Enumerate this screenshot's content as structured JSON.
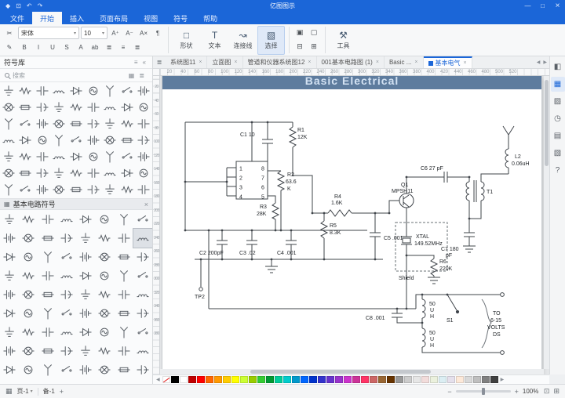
{
  "window": {
    "title": "亿图图示",
    "menu": [
      "文件",
      "开始",
      "插入",
      "页面布局",
      "视图",
      "符号",
      "帮助"
    ],
    "active_menu": "开始",
    "titlebar_icons": [
      {
        "name": "app-logo",
        "glyph": "◆"
      },
      {
        "name": "save",
        "glyph": "⊡"
      },
      {
        "name": "undo",
        "glyph": "↶"
      },
      {
        "name": "redo",
        "glyph": "↷"
      }
    ],
    "window_controls": [
      {
        "name": "minimize",
        "glyph": "—"
      },
      {
        "name": "maximize",
        "glyph": "□"
      },
      {
        "name": "close",
        "glyph": "×"
      }
    ]
  },
  "toolbar": {
    "font_family": "宋体",
    "font_size": "10",
    "chevron_glyph": "▾",
    "clipboard_icons": [
      {
        "name": "cut",
        "glyph": "✂"
      },
      {
        "name": "format-painter",
        "glyph": "✎"
      }
    ],
    "font_adjust_icons": [
      {
        "name": "grow-font",
        "glyph": "A⁺"
      },
      {
        "name": "shrink-font",
        "glyph": "A⁻"
      },
      {
        "name": "clear-format",
        "glyph": "A×"
      },
      {
        "name": "paragraph-mark",
        "glyph": "¶"
      }
    ],
    "format_icons": [
      {
        "name": "bold",
        "glyph": "B"
      },
      {
        "name": "italic",
        "glyph": "I"
      },
      {
        "name": "underline",
        "glyph": "U"
      },
      {
        "name": "strikethrough",
        "glyph": "S"
      },
      {
        "name": "font-color",
        "glyph": "A"
      },
      {
        "name": "text-highlight",
        "glyph": "ab"
      },
      {
        "name": "align-left",
        "glyph": "≣"
      },
      {
        "name": "align-center",
        "glyph": "≡"
      },
      {
        "name": "align-right",
        "glyph": "≣"
      }
    ],
    "big_buttons": [
      {
        "name": "shape-tool",
        "glyph": "□",
        "label": "形状"
      },
      {
        "name": "text-tool",
        "glyph": "T",
        "label": "文本"
      },
      {
        "name": "connector-tool",
        "glyph": "↝",
        "label": "连接线"
      },
      {
        "name": "select-tool",
        "glyph": "▧",
        "label": "选择",
        "active": true
      }
    ],
    "arrange_icons": [
      {
        "name": "bring-to-front",
        "glyph": "▣"
      },
      {
        "name": "send-to-back",
        "glyph": "▢"
      },
      {
        "name": "align-shapes",
        "glyph": "⊟"
      },
      {
        "name": "group-shapes",
        "glyph": "⊞"
      }
    ],
    "utility_buttons": [
      {
        "name": "tools",
        "glyph": "⚒",
        "label": "工具"
      }
    ]
  },
  "library": {
    "title": "符号库",
    "menu_glyph": "≡",
    "collapse_glyph": "«",
    "search_placeholder": "搜索",
    "view_icons": [
      {
        "name": "grid-view",
        "glyph": "▦"
      },
      {
        "name": "list-view",
        "glyph": "≣"
      }
    ],
    "section": "基本电路符号",
    "section_glyph": "▦",
    "close_glyph": "×",
    "symbol_cycle": [
      "ground",
      "resistor",
      "capacitor",
      "inductor",
      "diode",
      "ac-source",
      "antenna",
      "switch",
      "battery",
      "lamp",
      "fuse",
      "polar-capacitor"
    ],
    "top_count": 63,
    "bottom_count": 72,
    "selected_index": 15
  },
  "tabbar": {
    "menu_glyph": "≣",
    "close_glyph": "×",
    "arrows": [
      {
        "name": "scroll-tabs-left",
        "glyph": "◀"
      },
      {
        "name": "scroll-tabs-right",
        "glyph": "▶"
      }
    ]
  },
  "tabs": [
    {
      "label": "系统图11"
    },
    {
      "label": "立面图"
    },
    {
      "label": "管道和仪器系统图12"
    },
    {
      "label": "001基本电路图 (1)"
    },
    {
      "label": "Basic ..."
    },
    {
      "label": "基本电气",
      "active": true
    }
  ],
  "rulers": {
    "h": {
      "start": 20,
      "step": 20,
      "count": 26
    },
    "v": {
      "start": 20,
      "step": 20,
      "count": 19
    }
  },
  "circuit": {
    "title": "Basic Electrical",
    "labels": {
      "c1": "C1 10",
      "r1a": "R1",
      "r1b": "12K",
      "r2a": "R2",
      "r2b": "63.6",
      "r2c": "K",
      "r3a": "R3",
      "r3b": "28K",
      "c2": "C2 200pF",
      "c3": "C3 .02",
      "c4": "C4 .001",
      "tp2": "TP2",
      "r4a": "R4",
      "r4b": "1.6K",
      "r5a": "R5",
      "r5b": "8.3K",
      "c5": "C5 .001",
      "q1a": "Q1",
      "q1b": "MPSH11",
      "c6": "C6 27 pF",
      "t1": "T1",
      "xtala": "XTAL",
      "xtalb": "149.52MHz",
      "r6a": "R6",
      "r6b": "220K",
      "c7a": "C7 180",
      "c7b": "pF",
      "l2a": "L2",
      "l2b": "0.06uH",
      "shield": "Shield",
      "c8": "C8 .001",
      "l3a": "50",
      "l3b": "U",
      "l3c": "H",
      "l4a": "50",
      "l4b": "U",
      "l4c": "H",
      "s1": "S1",
      "toa": "TO",
      "tob": "6-15",
      "toc": "VOLTS",
      "tod": "DS",
      "pl1": "1",
      "pl2": "2",
      "pl3": "3",
      "pl4": "4",
      "pr1": "8",
      "pr2": "7",
      "pr3": "6",
      "pr4": "5"
    }
  },
  "right_panel": {
    "icons": [
      {
        "name": "format-panel",
        "glyph": "◧"
      },
      {
        "name": "symbol-panel",
        "glyph": "▦",
        "active": true
      },
      {
        "name": "clipart-panel",
        "glyph": "▨"
      },
      {
        "name": "history-panel",
        "glyph": "◷"
      },
      {
        "name": "layer-panel",
        "glyph": "▤"
      },
      {
        "name": "note-panel",
        "glyph": "▧"
      },
      {
        "name": "help-panel",
        "glyph": "?"
      }
    ]
  },
  "palette": {
    "left_glyph": "◀",
    "right_glyph": "▶",
    "colors": [
      "none",
      "#000000",
      "#ffffff",
      "#c00000",
      "#ff0000",
      "#ff6600",
      "#ff9900",
      "#ffcc00",
      "#ffff00",
      "#ccff33",
      "#99cc00",
      "#33cc33",
      "#009933",
      "#00cc99",
      "#00cccc",
      "#0099cc",
      "#0066ff",
      "#0033cc",
      "#3333cc",
      "#6633cc",
      "#9933cc",
      "#cc33cc",
      "#cc3399",
      "#ff3366",
      "#cc6666",
      "#996633",
      "#663300",
      "#999999",
      "#cccccc",
      "#e6e6e6",
      "#f2dcdb",
      "#ebf1dd",
      "#dbeef3",
      "#e5e0ec",
      "#fde9d9",
      "#d9d9d9",
      "#bfbfbf",
      "#808080",
      "#404040"
    ]
  },
  "statusbar": {
    "grid_glyph": "▦",
    "page_label": "页-1",
    "chevron_glyph": "▾",
    "sheet_label": "备-1",
    "add_glyph": "+",
    "zoom_out_glyph": "−",
    "zoom_in_glyph": "+",
    "zoom_percent": "100%",
    "fit_glyph": "⊡",
    "fullscreen_glyph": "⊞"
  }
}
